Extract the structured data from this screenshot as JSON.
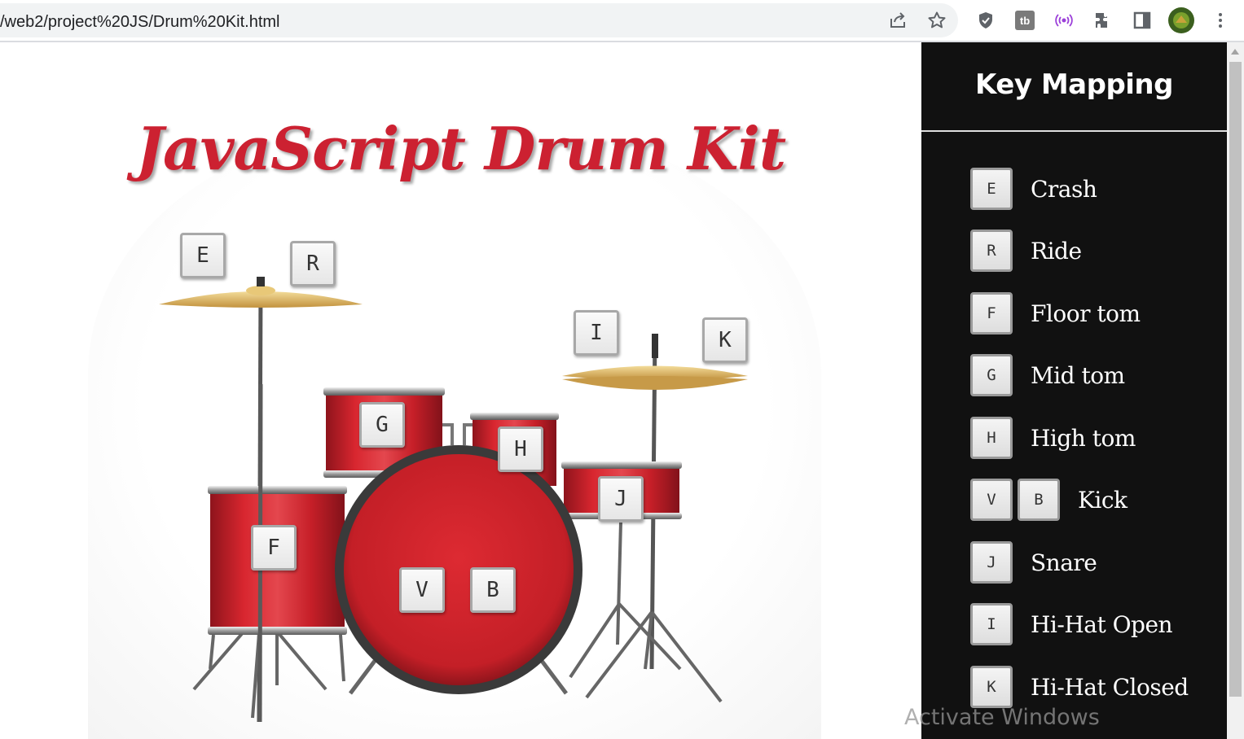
{
  "browser": {
    "url": "/web2/project%20JS/Drum%20Kit.html",
    "icons": [
      "share-icon",
      "star-icon",
      "shield-icon",
      "tb-extension-icon",
      "broadcast-icon",
      "puzzle-icon",
      "side-panel-icon",
      "avatar",
      "kebab-menu-icon"
    ]
  },
  "page": {
    "title": "JavaScript Drum Kit",
    "drum_keys": {
      "crash": "E",
      "ride": "R",
      "hihat_open": "I",
      "hihat_closed": "K",
      "mid_tom": "G",
      "high_tom": "H",
      "snare": "J",
      "floor_tom": "F",
      "kick_1": "V",
      "kick_2": "B"
    }
  },
  "sidebar": {
    "title": "Key Mapping",
    "items": [
      {
        "keys": [
          "E"
        ],
        "label": "Crash"
      },
      {
        "keys": [
          "R"
        ],
        "label": "Ride"
      },
      {
        "keys": [
          "F"
        ],
        "label": "Floor tom"
      },
      {
        "keys": [
          "G"
        ],
        "label": "Mid tom"
      },
      {
        "keys": [
          "H"
        ],
        "label": "High tom"
      },
      {
        "keys": [
          "V",
          "B"
        ],
        "label": "Kick"
      },
      {
        "keys": [
          "J"
        ],
        "label": "Snare"
      },
      {
        "keys": [
          "I"
        ],
        "label": "Hi-Hat Open"
      },
      {
        "keys": [
          "K"
        ],
        "label": "Hi-Hat Closed"
      }
    ]
  },
  "overlay": {
    "watermark": "Activate Windows"
  },
  "colors": {
    "title_red": "#cc2131",
    "drum_red": "#c8202b",
    "sidebar_bg": "#111111",
    "cymbal_gold": "#d9b56a"
  }
}
